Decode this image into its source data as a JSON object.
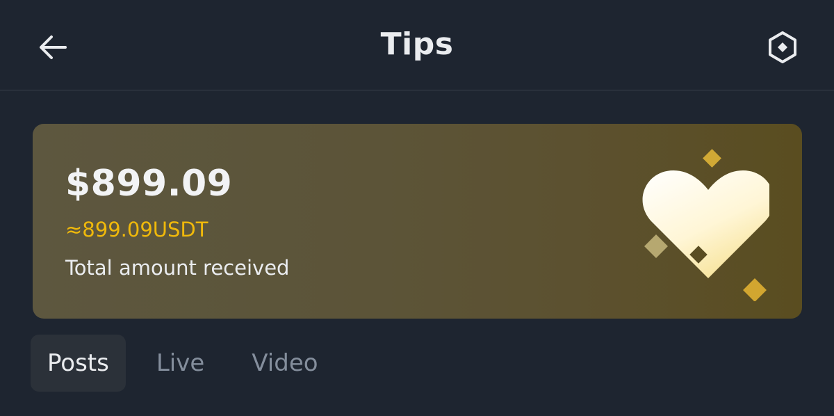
{
  "header": {
    "title": "Tips",
    "back_icon": "arrow-left-icon",
    "settings_icon": "hexagon-settings-icon"
  },
  "summary": {
    "amount": "$899.09",
    "converted": "≈899.09USDT",
    "caption": "Total amount received",
    "illustration_icon": "heart-sparkles-icon"
  },
  "tabs": [
    {
      "label": "Posts",
      "active": true
    },
    {
      "label": "Live",
      "active": false
    },
    {
      "label": "Video",
      "active": false
    }
  ],
  "colors": {
    "background": "#1e2530",
    "accent": "#f0b90b",
    "text": "#eaecef",
    "muted": "#848e9c"
  }
}
